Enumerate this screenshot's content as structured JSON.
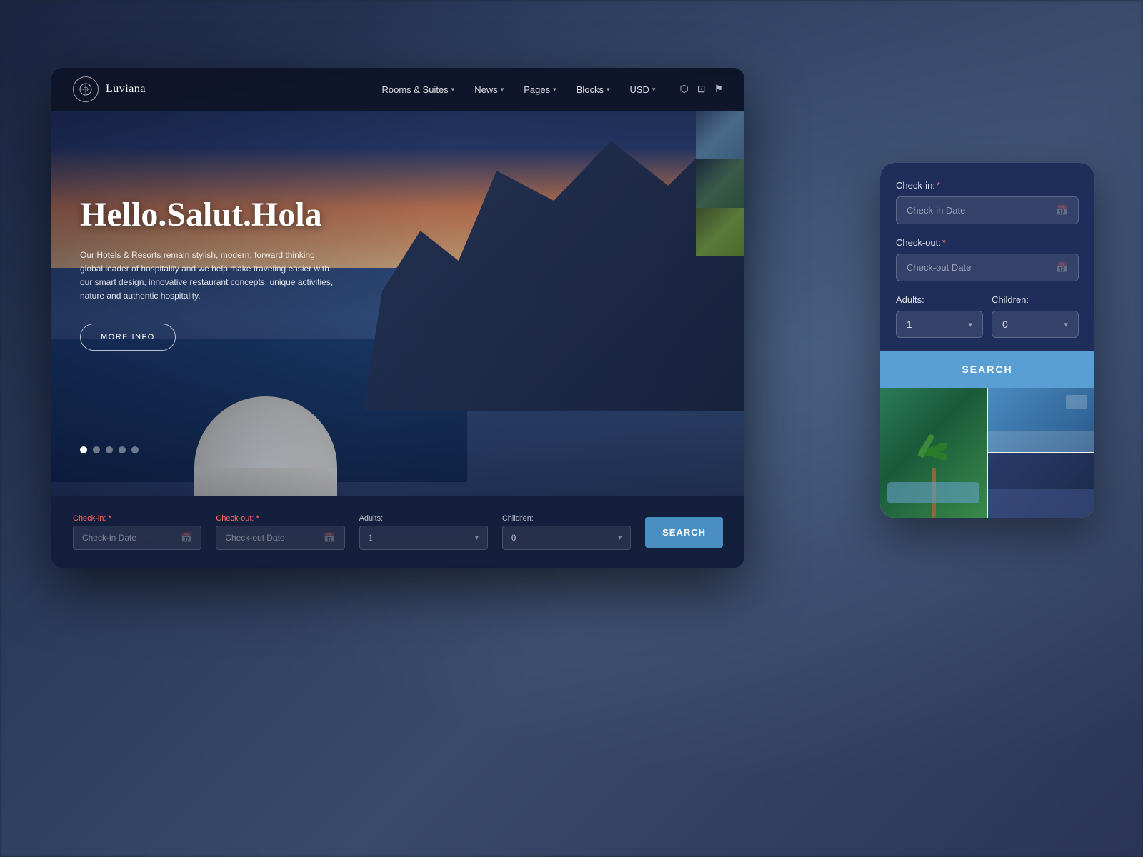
{
  "background": {
    "overlay_color": "#1a2a3a"
  },
  "laptop": {
    "navbar": {
      "logo_text": "Luviana",
      "nav_items": [
        {
          "label": "Rooms & Suites",
          "has_dropdown": true
        },
        {
          "label": "News",
          "has_dropdown": true
        },
        {
          "label": "Pages",
          "has_dropdown": true
        },
        {
          "label": "Blocks",
          "has_dropdown": true
        },
        {
          "label": "USD",
          "has_dropdown": true
        }
      ],
      "social_icons": [
        "instagram",
        "camera",
        "flag"
      ]
    },
    "hero": {
      "title": "Hello.Salut.Hola",
      "subtitle": "Our Hotels & Resorts remain stylish, modern, forward thinking global leader of hospitality and we help make traveling easier with our smart design, innovative restaurant concepts, unique activities, nature and authentic hospitality.",
      "cta_label": "MORE INFO"
    },
    "carousel": {
      "dots": [
        true,
        false,
        false,
        false,
        false
      ]
    },
    "booking_bar": {
      "checkin_label": "Check-in:",
      "checkin_req": "*",
      "checkin_placeholder": "Check-in Date",
      "checkout_label": "Check-out:",
      "checkout_req": "*",
      "checkout_placeholder": "Check-out Date",
      "adults_label": "Adults:",
      "adults_value": "1",
      "children_label": "Children:",
      "children_value": "0",
      "search_label": "SEARCH"
    }
  },
  "mobile_panel": {
    "checkin_label": "Check-in:",
    "checkin_req": "*",
    "checkin_placeholder": "Check-in Date",
    "checkout_label": "Check-out:",
    "checkout_req": "*",
    "checkout_placeholder": "Check-out Date",
    "adults_label": "Adults:",
    "adults_value": "1",
    "children_label": "Children:",
    "children_value": "0",
    "search_label": "SEARCH"
  }
}
